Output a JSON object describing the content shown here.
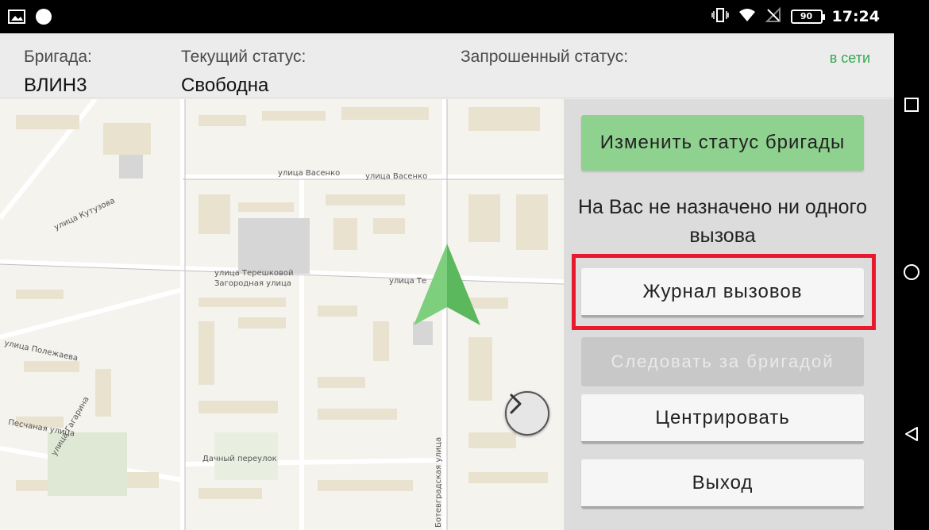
{
  "status_bar": {
    "time": "17:24",
    "battery": "90",
    "icons": [
      "image-icon",
      "circle-icon",
      "vibrate-icon",
      "wifi-icon",
      "no-signal-icon",
      "battery-icon"
    ]
  },
  "header": {
    "brigade_label": "Бригада:",
    "brigade_value": "ВЛИН3",
    "current_status_label": "Текущий статус:",
    "current_status_value": "Свободна",
    "requested_status_label": "Запрошенный статус:",
    "connection_status": "в сети"
  },
  "map": {
    "street_labels": [
      "улица Васенко",
      "улица Васенко",
      "улица Кутузова",
      "улица Терешковой",
      "Загородная улица",
      "улица Те",
      "улица Полежаева",
      "улица Гагарина",
      "Песчаная улица",
      "Дачный переулок",
      "Ботевградская улица"
    ],
    "location_marker": "navigation-arrow-icon"
  },
  "panel": {
    "change_status_button": "Изменить статус бригады",
    "notice": "На Вас не назначено ни одного вызова",
    "call_log_button": "Журнал вызовов",
    "follow_button": "Следовать за бригадой",
    "center_button": "Центрировать",
    "exit_button": "Выход"
  },
  "colors": {
    "accent_green": "#8fd18f",
    "online_green": "#34a853",
    "highlight_red": "#e8192c"
  }
}
